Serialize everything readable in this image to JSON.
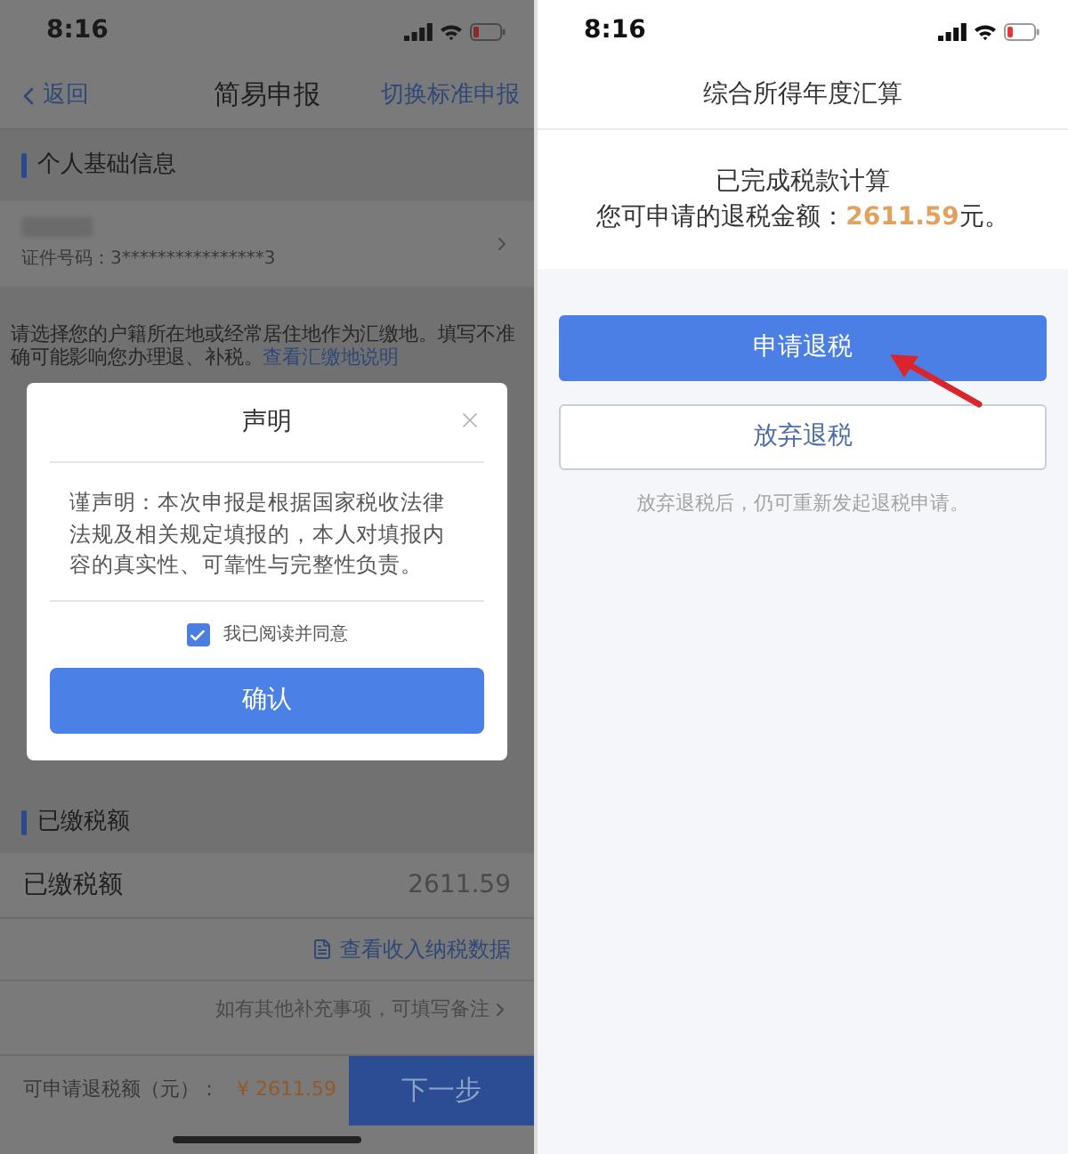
{
  "left_screen": {
    "status_bar": {
      "time": "8:16"
    },
    "nav": {
      "back_label": "返回",
      "title": "简易申报",
      "switch_link": "切换标准申报"
    },
    "personal_info": {
      "heading": "个人基础信息",
      "id_number": "证件号码：3****************3"
    },
    "notice": {
      "text": "请选择您的户籍所在地或经常居住地作为汇缴地。填写不准确可能影响您办理退、补税。",
      "link": "查看汇缴地说明"
    },
    "dialog": {
      "title": "声明",
      "body": "谨声明：本次申报是根据国家税收法律法规及相关规定填报的，本人对填报内容的真实性、可靠性与完整性负责。",
      "agree": {
        "label": "我已阅读并同意",
        "checked": true
      },
      "confirm_button": "确认"
    },
    "paid_tax": {
      "heading": "已缴税额",
      "label": "已缴税额",
      "value": "2611.59"
    },
    "income_link": "查看收入纳税数据",
    "remark_link": "如有其他补充事项，可填写备注",
    "footer": {
      "label": "可申请退税额（元）：",
      "amount": "¥ 2611.59",
      "next_button": "下一步"
    }
  },
  "right_screen": {
    "status_bar": {
      "time": "8:16"
    },
    "title": "综合所得年度汇算",
    "result": {
      "status": "已完成税款计算",
      "prefix": "您可申请的退税金额：",
      "amount": "2611.59",
      "suffix": "元。"
    },
    "apply_button": "申请退税",
    "abandon_button": "放弃退税",
    "hint": "放弃退税后，仍可重新发起退税申请。"
  }
}
